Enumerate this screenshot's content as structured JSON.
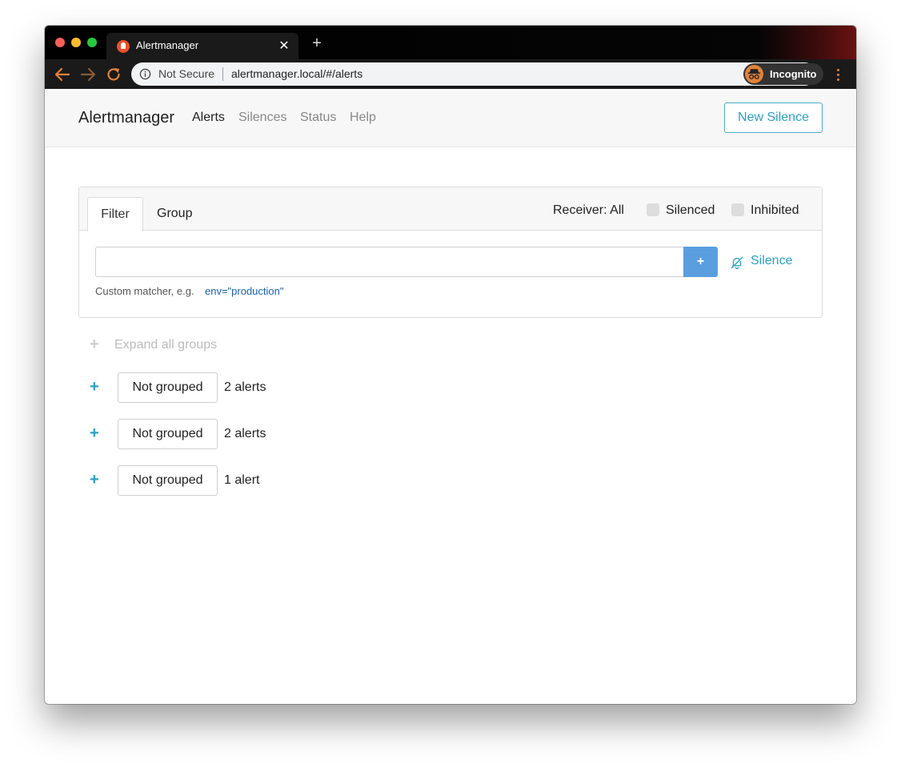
{
  "browser": {
    "tab_title": "Alertmanager",
    "tab_close": "✕",
    "new_tab": "+",
    "security_label": "Not Secure",
    "url": "alertmanager.local/#/alerts",
    "profile_label": "Incognito",
    "icons": {
      "back": "arrow-left-icon",
      "forward": "arrow-right-icon",
      "reload": "reload-icon",
      "info": "info-icon",
      "star": "star-icon",
      "incognito": "incognito-icon",
      "menu": "more-vert-icon"
    },
    "colors": {
      "nav_accent": "#e2823a"
    }
  },
  "navbar": {
    "brand": "Alertmanager",
    "links": [
      {
        "label": "Alerts",
        "active": true
      },
      {
        "label": "Silences",
        "active": false
      },
      {
        "label": "Status",
        "active": false
      },
      {
        "label": "Help",
        "active": false
      }
    ],
    "new_silence": "New Silence"
  },
  "filter": {
    "tabs": [
      "Filter",
      "Group"
    ],
    "active_tab": "Filter",
    "receiver": "Receiver: All",
    "checkboxes": [
      {
        "label": "Silenced",
        "checked": false
      },
      {
        "label": "Inhibited",
        "checked": false
      }
    ],
    "input_value": "",
    "add_button": "+",
    "silence_button": "Silence",
    "hint_prefix": "Custom matcher, e.g.",
    "hint_example": "env=\"production\""
  },
  "expand_all": {
    "icon": "+",
    "label": "Expand all groups"
  },
  "groups": [
    {
      "expand_icon": "+",
      "label": "Not grouped",
      "count": "2 alerts"
    },
    {
      "expand_icon": "+",
      "label": "Not grouped",
      "count": "2 alerts"
    },
    {
      "expand_icon": "+",
      "label": "Not grouped",
      "count": "1 alert"
    }
  ],
  "colors": {
    "accent": "#2aa1c6",
    "primary_button": "#5a9ee0",
    "link": "#1a5fb4"
  }
}
